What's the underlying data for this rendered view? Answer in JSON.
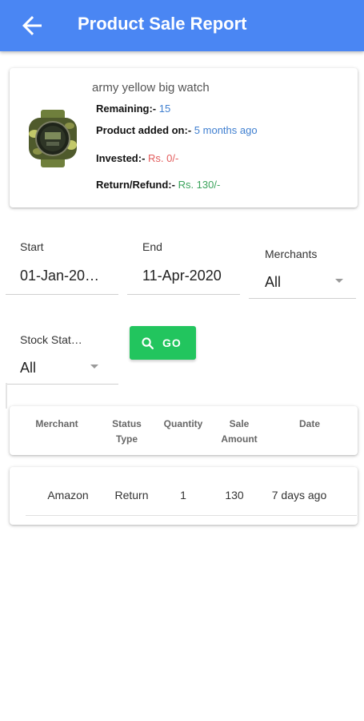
{
  "header": {
    "title": "Product Sale Report",
    "back_icon": "arrow-left-icon",
    "color": "#4a86f3"
  },
  "product": {
    "name": "army yellow big watch",
    "remaining_label": "Remaining:-",
    "remaining_value": "15",
    "added_label": "Product added on:-",
    "added_value": "5 months ago",
    "invested_label": "Invested:-",
    "invested_value": "Rs. 0/-",
    "return_label": "Return/Refund:-",
    "return_value": "Rs. 130/-"
  },
  "filters": {
    "start_label": "Start",
    "start_value": "01-Jan-20…",
    "end_label": "End",
    "end_value": "11-Apr-2020",
    "merchants_label": "Merchants",
    "merchants_value": "All",
    "stock_label": "Stock Stat…",
    "stock_value": "All",
    "go_label": "GO",
    "go_color": "#22c55e"
  },
  "table": {
    "headers": {
      "merchant": "Merchant",
      "status_1": "Status",
      "status_2": "Type",
      "quantity": "Quantity",
      "amount_1": "Sale",
      "amount_2": "Amount",
      "date": "Date"
    },
    "rows": [
      {
        "merchant": "Amazon",
        "status": "Return",
        "quantity": "1",
        "amount": "130",
        "date": "7 days ago"
      }
    ]
  }
}
